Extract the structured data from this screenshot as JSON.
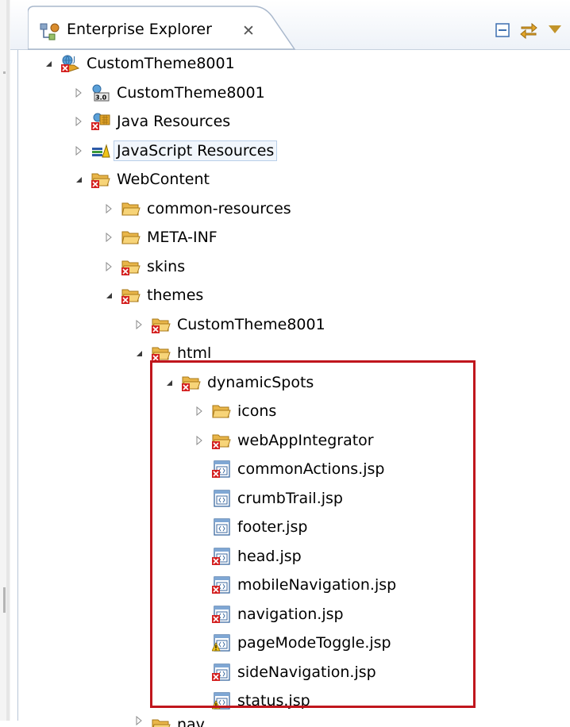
{
  "view": {
    "title": "Enterprise Explorer",
    "close_glyph": "✕"
  },
  "toolbar": [
    {
      "icon": "collapse-all-icon"
    },
    {
      "icon": "link-with-editor-icon"
    },
    {
      "icon": "view-menu-icon"
    }
  ],
  "tree": [
    {
      "label": "CustomTheme8001",
      "icon": "web-project-icon",
      "state": "expanded",
      "depth": 0
    },
    {
      "label": "CustomTheme8001",
      "icon": "deployment-descriptor-icon",
      "state": "collapsed",
      "depth": 1
    },
    {
      "label": "Java Resources",
      "icon": "java-resources-icon",
      "state": "collapsed",
      "depth": 1
    },
    {
      "label": "JavaScript Resources",
      "icon": "javascript-resources-icon",
      "state": "collapsed",
      "depth": 1,
      "selected": true
    },
    {
      "label": "WebContent",
      "icon": "folder-error-icon",
      "state": "expanded",
      "depth": 1
    },
    {
      "label": "common-resources",
      "icon": "folder-icon",
      "state": "collapsed",
      "depth": 2
    },
    {
      "label": "META-INF",
      "icon": "folder-icon",
      "state": "collapsed",
      "depth": 2
    },
    {
      "label": "skins",
      "icon": "folder-error-icon",
      "state": "collapsed",
      "depth": 2
    },
    {
      "label": "themes",
      "icon": "folder-error-icon",
      "state": "expanded",
      "depth": 2
    },
    {
      "label": "CustomTheme8001",
      "icon": "folder-error-icon",
      "state": "collapsed",
      "depth": 3
    },
    {
      "label": "html",
      "icon": "folder-error-icon",
      "state": "expanded",
      "depth": 3
    },
    {
      "label": "dynamicSpots",
      "icon": "folder-error-icon",
      "state": "expanded",
      "depth": 4
    },
    {
      "label": "icons",
      "icon": "folder-icon",
      "state": "collapsed",
      "depth": 5
    },
    {
      "label": "webAppIntegrator",
      "icon": "folder-error-icon",
      "state": "collapsed",
      "depth": 5
    },
    {
      "label": "commonActions.jsp",
      "icon": "jsp-file-error-icon",
      "state": "leaf",
      "depth": 5
    },
    {
      "label": "crumbTrail.jsp",
      "icon": "jsp-file-icon",
      "state": "leaf",
      "depth": 5
    },
    {
      "label": "footer.jsp",
      "icon": "jsp-file-icon",
      "state": "leaf",
      "depth": 5
    },
    {
      "label": "head.jsp",
      "icon": "jsp-file-error-icon",
      "state": "leaf",
      "depth": 5
    },
    {
      "label": "mobileNavigation.jsp",
      "icon": "jsp-file-error-icon",
      "state": "leaf",
      "depth": 5
    },
    {
      "label": "navigation.jsp",
      "icon": "jsp-file-error-icon",
      "state": "leaf",
      "depth": 5
    },
    {
      "label": "pageModeToggle.jsp",
      "icon": "jsp-file-warning-icon",
      "state": "leaf",
      "depth": 5
    },
    {
      "label": "sideNavigation.jsp",
      "icon": "jsp-file-error-icon",
      "state": "leaf",
      "depth": 5
    },
    {
      "label": "status.jsp",
      "icon": "jsp-file-warning-icon",
      "state": "leaf",
      "depth": 5
    },
    {
      "label": "nav",
      "icon": "folder-icon",
      "state": "collapsed",
      "depth": 3,
      "partial": true
    }
  ],
  "colors": {
    "error": "#d42020",
    "warning": "#e8b800",
    "folder": "#f3c64e",
    "highlight_box": "#c0161d"
  }
}
